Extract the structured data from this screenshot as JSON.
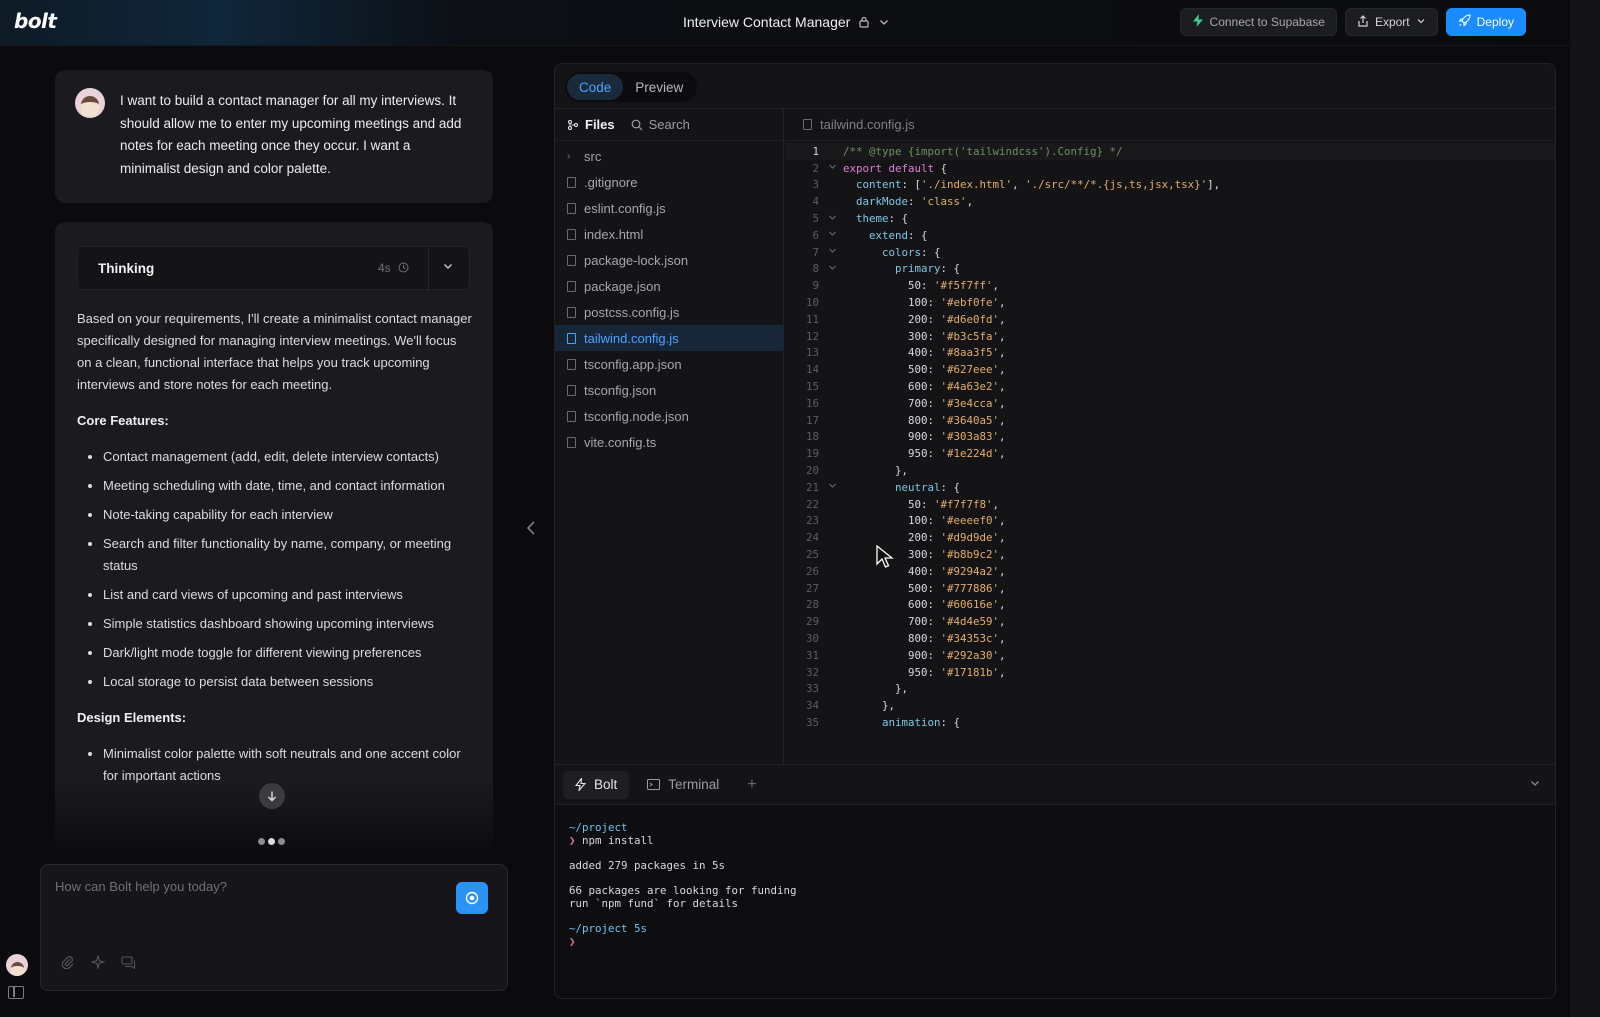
{
  "header": {
    "logo": "bolt",
    "project_title": "Interview Contact Manager",
    "connect_label": "Connect to Supabase",
    "export_label": "Export",
    "deploy_label": "Deploy"
  },
  "chat": {
    "user_message": "I want to build a contact manager for all my interviews. It should allow me to enter my upcoming meetings and add notes for each meeting once they occur. I want a minimalist design and color palette.",
    "thinking_label": "Thinking",
    "thinking_time": "4s",
    "intro": "Based on your requirements, I'll create a minimalist contact manager specifically designed for managing interview meetings. We'll focus on a clean, functional interface that helps you track upcoming interviews and store notes for each meeting.",
    "core_heading": "Core Features:",
    "core_features": [
      "Contact management (add, edit, delete interview contacts)",
      "Meeting scheduling with date, time, and contact information",
      "Note-taking capability for each interview",
      "Search and filter functionality by name, company, or meeting status",
      "List and card views of upcoming and past interviews",
      "Simple statistics dashboard showing upcoming interviews",
      "Dark/light mode toggle for different viewing preferences",
      "Local storage to persist data between sessions"
    ],
    "design_heading": "Design Elements:",
    "design_elements": [
      "Minimalist color palette with soft neutrals and one accent color for important actions"
    ],
    "prompt_placeholder": "How can Bolt help you today?"
  },
  "workbench": {
    "tabs": [
      "Code",
      "Preview"
    ],
    "active_tab": "Code",
    "files_label": "Files",
    "search_label": "Search",
    "files": [
      {
        "name": "src",
        "type": "folder"
      },
      {
        "name": ".gitignore",
        "type": "file"
      },
      {
        "name": "eslint.config.js",
        "type": "file"
      },
      {
        "name": "index.html",
        "type": "file"
      },
      {
        "name": "package-lock.json",
        "type": "file"
      },
      {
        "name": "package.json",
        "type": "file"
      },
      {
        "name": "postcss.config.js",
        "type": "file"
      },
      {
        "name": "tailwind.config.js",
        "type": "file",
        "active": true
      },
      {
        "name": "tsconfig.app.json",
        "type": "file"
      },
      {
        "name": "tsconfig.json",
        "type": "file"
      },
      {
        "name": "tsconfig.node.json",
        "type": "file"
      },
      {
        "name": "vite.config.ts",
        "type": "file"
      }
    ],
    "open_file": "tailwind.config.js",
    "code_lines": [
      "/** @type {import('tailwindcss').Config} */",
      "export default {",
      "  content: ['./index.html', './src/**/*.{js,ts,jsx,tsx}'],",
      "  darkMode: 'class',",
      "  theme: {",
      "    extend: {",
      "      colors: {",
      "        primary: {",
      "          50: '#f5f7ff',",
      "          100: '#ebf0fe',",
      "          200: '#d6e0fd',",
      "          300: '#b3c5fa',",
      "          400: '#8aa3f5',",
      "          500: '#627eee',",
      "          600: '#4a63e2',",
      "          700: '#3e4cca',",
      "          800: '#3640a5',",
      "          900: '#303a83',",
      "          950: '#1e224d',",
      "        },",
      "        neutral: {",
      "          50: '#f7f7f8',",
      "          100: '#eeeef0',",
      "          200: '#d9d9de',",
      "          300: '#b8b9c2',",
      "          400: '#9294a2',",
      "          500: '#777886',",
      "          600: '#60616e',",
      "          700: '#4d4e59',",
      "          800: '#34353c',",
      "          900: '#292a30',",
      "          950: '#17181b',",
      "        },",
      "      },",
      "      animation: {"
    ],
    "fold_lines": [
      2,
      5,
      6,
      7,
      8,
      21
    ]
  },
  "terminal": {
    "tabs": [
      "Bolt",
      "Terminal"
    ],
    "active_tab": "Bolt",
    "lines": [
      {
        "text": "~/project",
        "style": "cyan"
      },
      {
        "text": "❯ npm install",
        "style": "cmd"
      },
      {
        "text": "",
        "style": "gap"
      },
      {
        "text": "added 279 packages in 5s",
        "style": "plain"
      },
      {
        "text": "",
        "style": "gap"
      },
      {
        "text": "66 packages are looking for funding",
        "style": "plain"
      },
      {
        "text": "  run `npm fund` for details",
        "style": "plain"
      },
      {
        "text": "",
        "style": "gap"
      },
      {
        "text": "~/project 5s",
        "style": "cyan"
      },
      {
        "text": "❯",
        "style": "prompt"
      }
    ]
  },
  "colors": {
    "accent": "#1a8cff",
    "active_tab_text": "#4aa3ff",
    "supabase": "#3ecf8e"
  }
}
